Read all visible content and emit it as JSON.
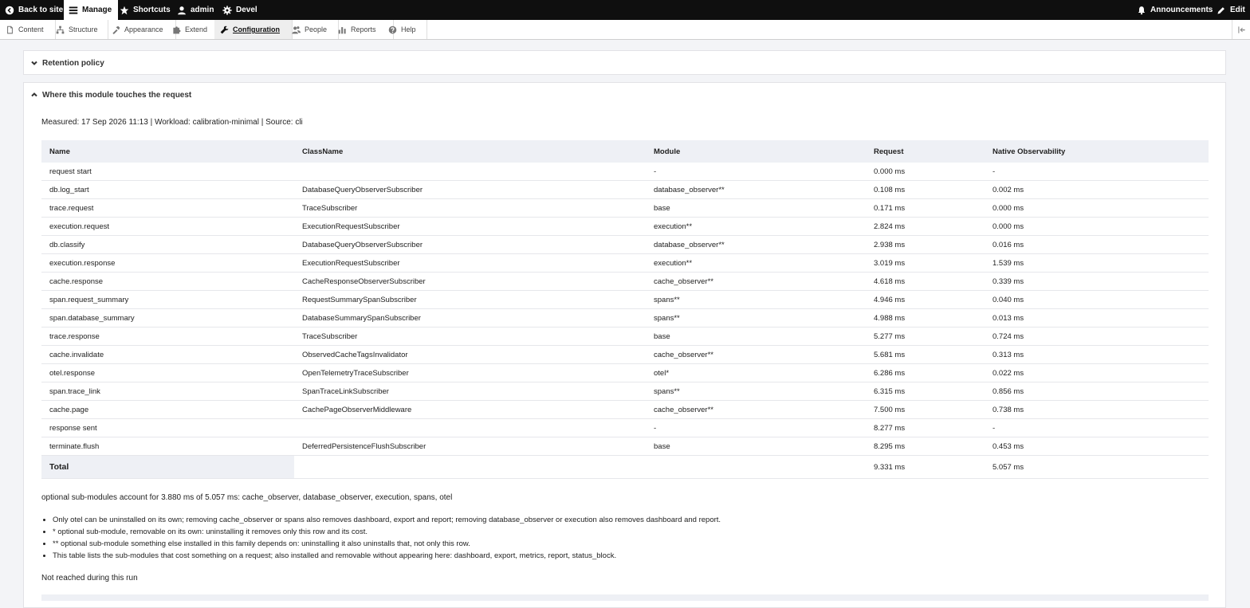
{
  "toolbar": {
    "back": "Back to site",
    "manage": "Manage",
    "shortcuts": "Shortcuts",
    "user": "admin",
    "devel": "Devel",
    "announcements": "Announcements",
    "edit": "Edit"
  },
  "tray": {
    "content": "Content",
    "structure": "Structure",
    "appearance": "Appearance",
    "extend": "Extend",
    "configuration": "Configuration",
    "people": "People",
    "reports": "Reports",
    "help": "Help"
  },
  "sections": {
    "retention": "Retention policy",
    "touches": "Where this module touches the request"
  },
  "measured": "Measured: 17 Sep 2026 11:13 | Workload: calibration-minimal | Source: cli",
  "table": {
    "headers": [
      "Name",
      "ClassName",
      "Module",
      "Request",
      "Native Observability"
    ],
    "rows": [
      [
        "request start",
        "",
        "-",
        "0.000 ms",
        "-"
      ],
      [
        "db.log_start",
        "DatabaseQueryObserverSubscriber",
        "database_observer**",
        "0.108 ms",
        "0.002 ms"
      ],
      [
        "trace.request",
        "TraceSubscriber",
        "base",
        "0.171 ms",
        "0.000 ms"
      ],
      [
        "execution.request",
        "ExecutionRequestSubscriber",
        "execution**",
        "2.824 ms",
        "0.000 ms"
      ],
      [
        "db.classify",
        "DatabaseQueryObserverSubscriber",
        "database_observer**",
        "2.938 ms",
        "0.016 ms"
      ],
      [
        "execution.response",
        "ExecutionRequestSubscriber",
        "execution**",
        "3.019 ms",
        "1.539 ms"
      ],
      [
        "cache.response",
        "CacheResponseObserverSubscriber",
        "cache_observer**",
        "4.618 ms",
        "0.339 ms"
      ],
      [
        "span.request_summary",
        "RequestSummarySpanSubscriber",
        "spans**",
        "4.946 ms",
        "0.040 ms"
      ],
      [
        "span.database_summary",
        "DatabaseSummarySpanSubscriber",
        "spans**",
        "4.988 ms",
        "0.013 ms"
      ],
      [
        "trace.response",
        "TraceSubscriber",
        "base",
        "5.277 ms",
        "0.724 ms"
      ],
      [
        "cache.invalidate",
        "ObservedCacheTagsInvalidator",
        "cache_observer**",
        "5.681 ms",
        "0.313 ms"
      ],
      [
        "otel.response",
        "OpenTelemetryTraceSubscriber",
        "otel*",
        "6.286 ms",
        "0.022 ms"
      ],
      [
        "span.trace_link",
        "SpanTraceLinkSubscriber",
        "spans**",
        "6.315 ms",
        "0.856 ms"
      ],
      [
        "cache.page",
        "CachePageObserverMiddleware",
        "cache_observer**",
        "7.500 ms",
        "0.738 ms"
      ],
      [
        "response sent",
        "",
        "-",
        "8.277 ms",
        "-"
      ],
      [
        "terminate.flush",
        "DeferredPersistenceFlushSubscriber",
        "base",
        "8.295 ms",
        "0.453 ms"
      ]
    ],
    "total": {
      "label": "Total",
      "request": "9.331 ms",
      "native": "5.057 ms"
    }
  },
  "summary_line": "optional sub-modules account for 3.880 ms of 5.057 ms: cache_observer, database_observer, execution, spans, otel",
  "notes": [
    "Only otel can be uninstalled on its own; removing cache_observer or spans also removes dashboard, export and report; removing database_observer or execution also removes dashboard and report.",
    "* optional sub-module, removable on its own: uninstalling it removes only this row and its cost.",
    "** optional sub-module something else installed in this family depends on: uninstalling it also uninstalls that, not only this row.",
    "This table lists the sub-modules that cost something on a request; also installed and removable without appearing here: dashboard, export, metrics, report, status_block."
  ],
  "not_reached": "Not reached during this run"
}
